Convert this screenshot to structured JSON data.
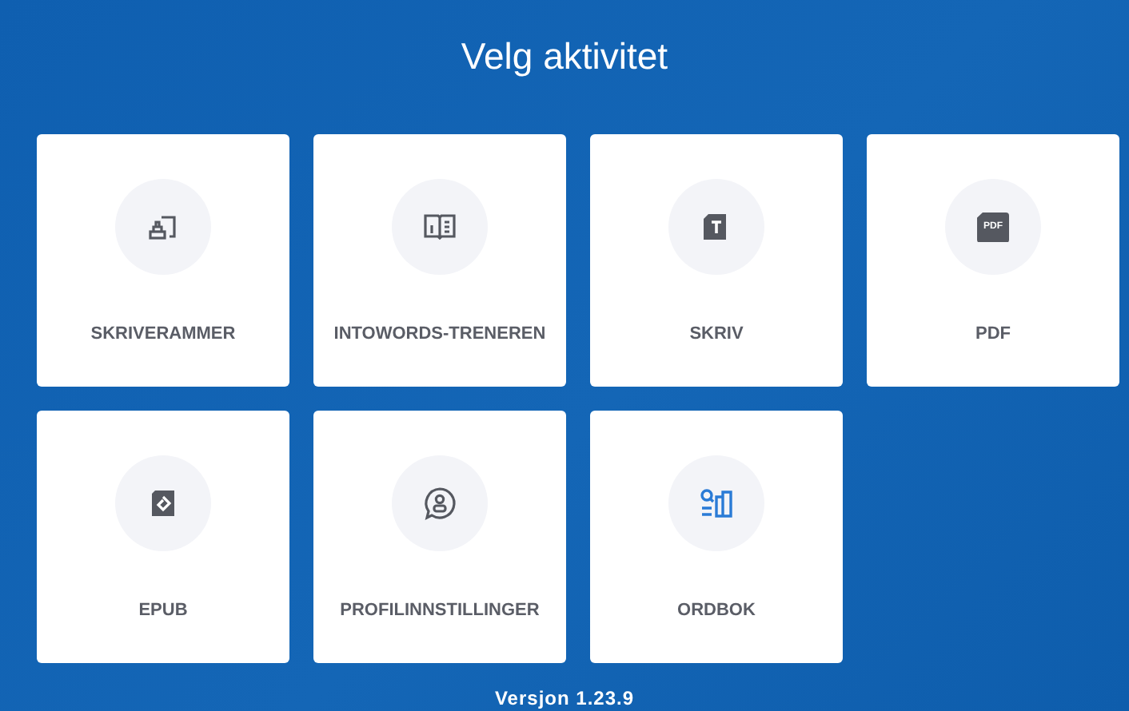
{
  "title": "Velg aktivitet",
  "activities": [
    {
      "label": "SKRIVERAMMER",
      "kind": "frames"
    },
    {
      "label": "INTOWORDS-TRENEREN",
      "kind": "book"
    },
    {
      "label": "SKRIV",
      "kind": "text"
    },
    {
      "label": "PDF",
      "kind": "pdf",
      "icon_text": "PDF"
    },
    {
      "label": "EPUB",
      "kind": "epub"
    },
    {
      "label": "PROFILINNSTILLINGER",
      "kind": "profile"
    },
    {
      "label": "ORDBOK",
      "kind": "dictionary"
    }
  ],
  "version": "Versjon 1.23.9"
}
